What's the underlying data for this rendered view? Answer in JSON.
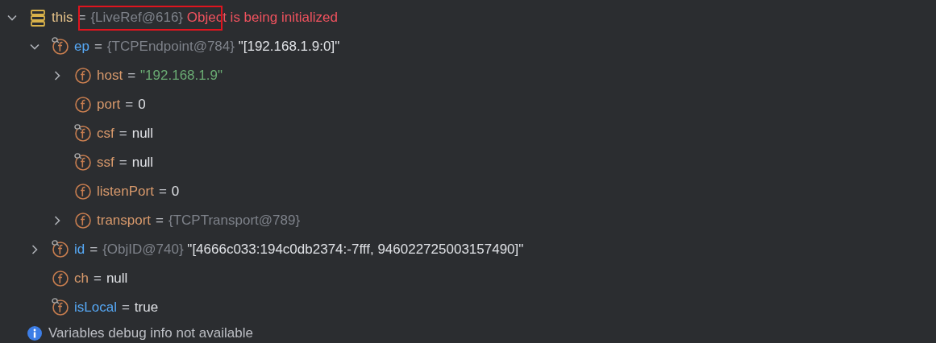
{
  "tree": [
    {
      "kind": "object",
      "name": "this",
      "modified": false,
      "operator": "=",
      "type": "{LiveRef@616}",
      "value": {
        "kind": "error",
        "text": "Object is being initialized"
      },
      "expanded": true,
      "highlight": true,
      "children": [
        {
          "kind": "field_watched",
          "name": "ep",
          "modified": true,
          "operator": "=",
          "type": "{TCPEndpoint@784}",
          "value": {
            "kind": "plain",
            "text": "\"[192.168.1.9:0]\""
          },
          "expanded": true,
          "children": [
            {
              "kind": "field",
              "name": "host",
              "modified": false,
              "operator": "=",
              "value": {
                "kind": "string",
                "text": "\"192.168.1.9\""
              },
              "expanded": false
            },
            {
              "kind": "field",
              "name": "port",
              "modified": false,
              "operator": "=",
              "value": {
                "kind": "plain",
                "text": "0"
              }
            },
            {
              "kind": "field_watched",
              "name": "csf",
              "modified": false,
              "operator": "=",
              "value": {
                "kind": "plain",
                "text": "null"
              }
            },
            {
              "kind": "field_watched",
              "name": "ssf",
              "modified": false,
              "operator": "=",
              "value": {
                "kind": "plain",
                "text": "null"
              }
            },
            {
              "kind": "field",
              "name": "listenPort",
              "modified": false,
              "operator": "=",
              "value": {
                "kind": "plain",
                "text": "0"
              }
            },
            {
              "kind": "field",
              "name": "transport",
              "modified": false,
              "operator": "=",
              "type": "{TCPTransport@789}",
              "expanded": false
            }
          ]
        },
        {
          "kind": "field_watched",
          "name": "id",
          "modified": true,
          "operator": "=",
          "type": "{ObjID@740}",
          "value": {
            "kind": "plain",
            "text": "\"[4666c033:194c0db2374:-7fff, 946022725003157490]\""
          },
          "expanded": false
        },
        {
          "kind": "field",
          "name": "ch",
          "modified": false,
          "operator": "=",
          "value": {
            "kind": "plain",
            "text": "null"
          }
        },
        {
          "kind": "field_watched",
          "name": "isLocal",
          "modified": true,
          "operator": "=",
          "value": {
            "kind": "plain",
            "text": "true"
          }
        }
      ]
    }
  ],
  "message": {
    "text": "Variables debug info not available"
  }
}
